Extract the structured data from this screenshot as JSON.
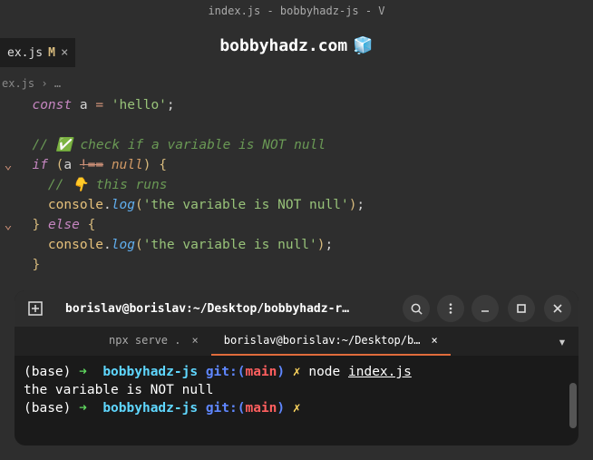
{
  "window": {
    "title": "index.js - bobbyhadz-js - V"
  },
  "banner": {
    "text": "bobbyhadz.com",
    "icon": "🧊"
  },
  "tab": {
    "name": "ex.js",
    "modified": "M"
  },
  "breadcrumb": {
    "file": "ex.js",
    "sep": "›",
    "more": "…"
  },
  "code": {
    "l1": {
      "kw": "const",
      "var": "a",
      "eq": "=",
      "str": "'hello'",
      "semi": ";"
    },
    "l2": {
      "cm": "// ✅ check if a variable is NOT null"
    },
    "l3": {
      "kw": "if",
      "lp": "(",
      "var": "a",
      "op": "!==",
      "null": "null",
      "rp": ")",
      "lb": "{"
    },
    "l4": {
      "cm": "// 👇 this runs"
    },
    "l5": {
      "obj": "console",
      "dot": ".",
      "fn": "log",
      "lp": "(",
      "str": "'the variable is NOT null'",
      "rp": ")",
      "semi": ";"
    },
    "l6": {
      "rb": "}",
      "kw": "else",
      "lb": "{"
    },
    "l7": {
      "obj": "console",
      "dot": ".",
      "fn": "log",
      "lp": "(",
      "str": "'the variable is null'",
      "rp": ")",
      "semi": ";"
    },
    "l8": {
      "rb": "}"
    }
  },
  "terminal": {
    "title": "borislav@borislav:~/Desktop/bobbyhadz-r…",
    "tabs": [
      {
        "label": "npx serve .",
        "active": false
      },
      {
        "label": "borislav@borislav:~/Desktop/b…",
        "active": true
      }
    ],
    "lines": {
      "p1": {
        "base": "(base)",
        "arrow": "➜",
        "dir": "bobbyhadz-js",
        "git": "git:(",
        "branch": "main",
        "gitclose": ")",
        "flash": "✗",
        "cmd": "node",
        "arg": "index.js"
      },
      "out1": "the variable is NOT null",
      "p2": {
        "base": "(base)",
        "arrow": "➜",
        "dir": "bobbyhadz-js",
        "git": "git:(",
        "branch": "main",
        "gitclose": ")",
        "flash": "✗"
      }
    }
  }
}
